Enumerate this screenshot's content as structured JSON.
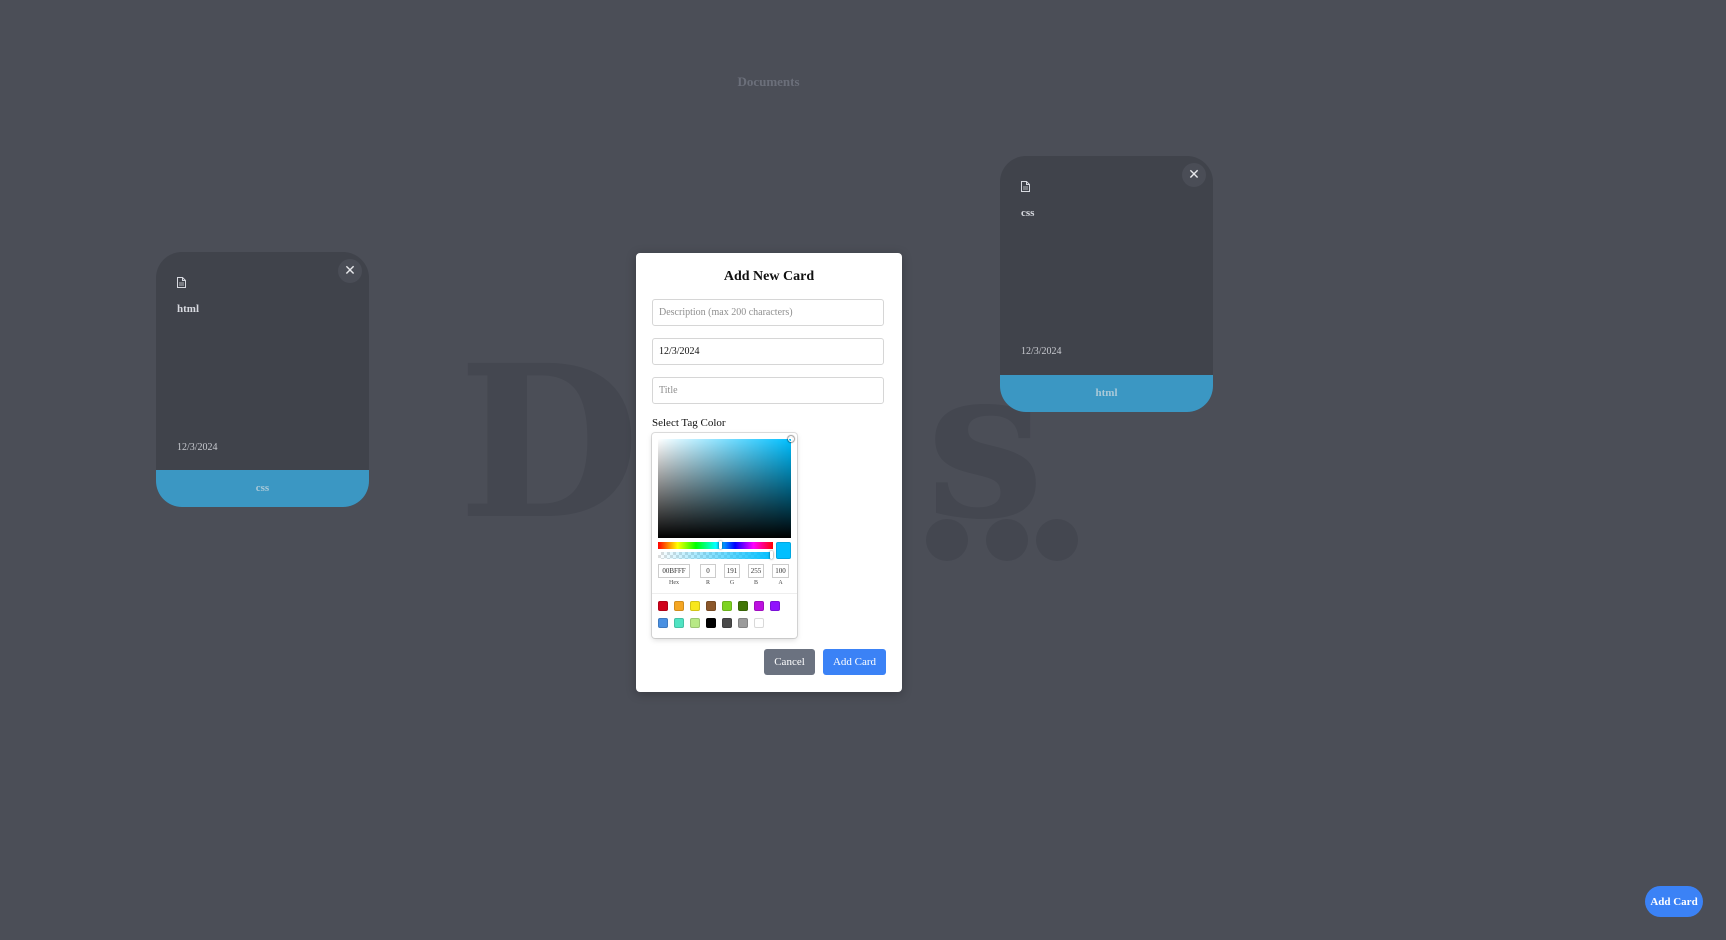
{
  "page": {
    "heading": "Documents",
    "background_text": "Do",
    "background_text_2": "s",
    "add_card_fab": "Add Card"
  },
  "colors": {
    "page_bg": "#4b4e57",
    "card_bg": "#40434b",
    "tag_color": "#3b97c3",
    "primary": "#3b82f6",
    "secondary": "#6b7280"
  },
  "cards": [
    {
      "icon": "document-icon",
      "close_icon": "close-icon",
      "close_glyph": "✕",
      "description": "html",
      "date": "12/3/2024",
      "tag": "css"
    },
    {
      "icon": "document-icon",
      "close_icon": "close-icon",
      "close_glyph": "✕",
      "description": "css",
      "date": "12/3/2024",
      "tag": "html"
    }
  ],
  "modal": {
    "title": "Add New Card",
    "description_placeholder": "Description (max 200 characters)",
    "date_value": "12/3/2024",
    "title_placeholder": "Title",
    "tag_color_label": "Select Tag Color",
    "cancel_label": "Cancel",
    "submit_label": "Add Card"
  },
  "color_picker": {
    "selected_color": "#00BFFF",
    "hue_position": 0.54,
    "alpha_position": 1.0,
    "fields": [
      {
        "label": "Hex",
        "value": "00BFFF"
      },
      {
        "label": "R",
        "value": "0"
      },
      {
        "label": "G",
        "value": "191"
      },
      {
        "label": "B",
        "value": "255"
      },
      {
        "label": "A",
        "value": "100"
      }
    ],
    "presets_row_1": [
      "#d0021b",
      "#f5a623",
      "#f8e71c",
      "#8b572a",
      "#7ed321",
      "#417505",
      "#bd10e0",
      "#9013fe"
    ],
    "presets_row_2": [
      "#4a90e2",
      "#50e3c2",
      "#b8e986",
      "#000000",
      "#4a4a4a",
      "#9b9b9b",
      "#ffffff"
    ]
  }
}
